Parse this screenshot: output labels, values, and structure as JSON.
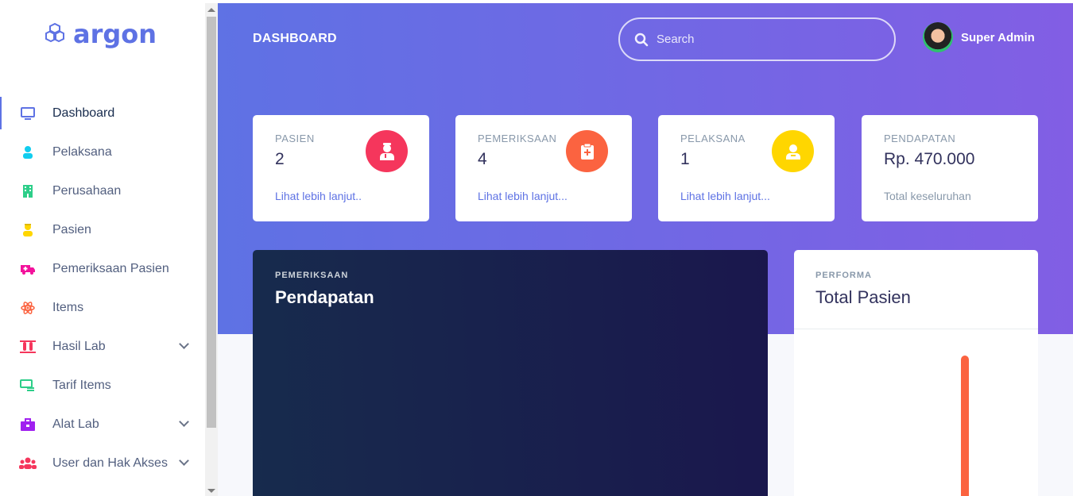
{
  "sidebar": {
    "brand": "argon",
    "items": [
      {
        "label": "Dashboard",
        "icon": "monitor-icon",
        "color": "#5e72e4",
        "active": true,
        "expandable": false
      },
      {
        "label": "Pelaksana",
        "icon": "user-icon",
        "color": "#11cdef",
        "expandable": false
      },
      {
        "label": "Perusahaan",
        "icon": "building-icon",
        "color": "#2dce89",
        "expandable": false
      },
      {
        "label": "Pasien",
        "icon": "patient-icon",
        "color": "#ffd600",
        "expandable": false
      },
      {
        "label": "Pemeriksaan Pasien",
        "icon": "ambulance-icon",
        "color": "#f3129c",
        "expandable": false
      },
      {
        "label": "Items",
        "icon": "atom-icon",
        "color": "#fb6340",
        "expandable": false
      },
      {
        "label": "Hasil Lab",
        "icon": "test-tubes-icon",
        "color": "#f5365c",
        "expandable": true
      },
      {
        "label": "Tarif Items",
        "icon": "money-icon",
        "color": "#2dce89",
        "expandable": false
      },
      {
        "label": "Alat Lab",
        "icon": "briefcase-icon",
        "color": "#a020f0",
        "expandable": true
      },
      {
        "label": "User dan Hak Akses",
        "icon": "users-icon",
        "color": "#f5365c",
        "expandable": true
      }
    ]
  },
  "header": {
    "title": "DASHBOARD",
    "search_placeholder": "Search",
    "user_name": "Super Admin"
  },
  "stats": [
    {
      "caption": "PASIEN",
      "value": "2",
      "link": "Lihat lebih lanjut..",
      "icon": "patient-icon",
      "color": "#f5365c"
    },
    {
      "caption": "PEMERIKSAAN",
      "value": "4",
      "link": "Lihat lebih lanjut...",
      "icon": "clipboard-medical-icon",
      "color": "#fb6340"
    },
    {
      "caption": "PELAKSANA",
      "value": "1",
      "link": "Lihat lebih lanjut...",
      "icon": "user-icon",
      "color": "#ffd600"
    },
    {
      "caption": "PENDAPATAN",
      "value": "Rp. 470.000",
      "link": "Total keseluruhan",
      "icon": "",
      "color": ""
    }
  ],
  "card_pendapatan": {
    "overline": "PEMERIKSAAN",
    "title": "Pendapatan"
  },
  "card_pasien": {
    "overline": "PERFORMA",
    "title": "Total Pasien"
  }
}
